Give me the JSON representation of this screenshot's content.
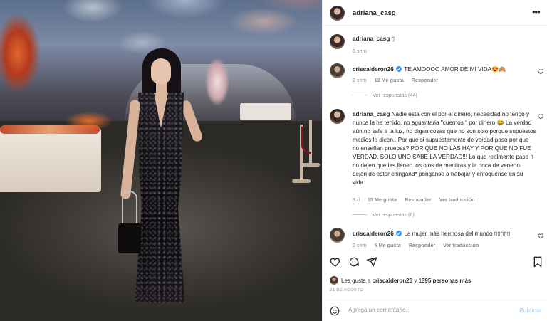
{
  "post": {
    "username": "adriana_casg",
    "caption_username": "adriana_casg",
    "caption_text": "▯",
    "caption_time": "6 sem"
  },
  "comments": [
    {
      "username": "criscalderon26",
      "verified": true,
      "text": "TE AMOOOO AMOR DE MI VIDA😍🙈",
      "time": "2 sem",
      "likes": "12 Me gusta",
      "reply": "Responder",
      "view_replies": "Ver respuestas (44)"
    },
    {
      "username": "adriana_casg",
      "verified": false,
      "text": "Nadie esta con el por el dinero, necesidad no tengo y nunca la he tenido, no aguantaria \"cuernos \" por dinero 😂 La verdad aún no sale a la luz, no digan cosas que no son solo porque supuestos medios lo dicen.. Por que si supuestamente de verdad paso por que no enseñan pruebas? POR QUE NO LAS HAY Y POR QUE NO FUE VERDAD. SOLO UNO SABE LA VERDAD!!! Lo que realmente paso ▯ no dejen que les llenen los ojos de mentiras y la boca de veneno. dejen de estar chingand* pónganse a trabajar y enfóquense en su vida.",
      "time": "3 d",
      "likes": "15 Me gusta",
      "reply": "Responder",
      "translate": "Ver traducción",
      "view_replies": "Ver respuestas (6)"
    },
    {
      "username": "criscalderon26",
      "verified": true,
      "text": "La mujer más hermosa del mundo ▯▯▯▯▯",
      "time": "2 sem",
      "likes": "6 Me gusta",
      "reply": "Responder",
      "translate": "Ver traducción"
    }
  ],
  "likes_line": {
    "prefix": "Les gusta a ",
    "user": "criscalderon26",
    "middle": " y ",
    "others": "1395 personas más"
  },
  "date": "21 DE AGOSTO",
  "comment_box": {
    "placeholder": "Agrega un comentario...",
    "post_label": "Publicar"
  },
  "icons": [
    "more-options-icon",
    "heart-icon",
    "comment-icon",
    "share-icon",
    "bookmark-icon",
    "emoji-icon",
    "verified-badge-icon"
  ],
  "colors": {
    "verified": "#3897f0",
    "muted": "#8e8e8e",
    "post_button": "#b3dbff"
  }
}
